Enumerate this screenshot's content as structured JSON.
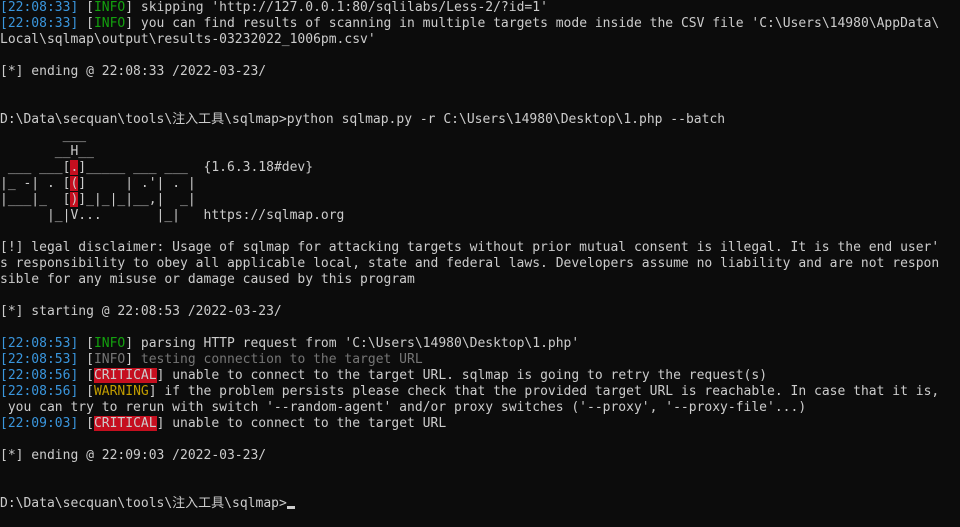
{
  "colors": {
    "background": "#0c0c0c",
    "text": "#cccccc",
    "timestamp": "#3a96dd",
    "info": "#13a10e",
    "warning": "#c19c00",
    "critical_bg": "#c50f1f",
    "dim": "#767676"
  },
  "lines": [
    {
      "segs": [
        [
          "ts",
          "[22:08:33]"
        ],
        [
          "txt",
          " ["
        ],
        [
          "info",
          "INFO"
        ],
        [
          "txt",
          "] skipping 'http://127.0.0.1:80/sqlilabs/Less-2/?id=1'"
        ]
      ]
    },
    {
      "segs": [
        [
          "ts",
          "[22:08:33]"
        ],
        [
          "txt",
          " ["
        ],
        [
          "info",
          "INFO"
        ],
        [
          "txt",
          "] you can find results of scanning in multiple targets mode inside the CSV file 'C:\\Users\\14980\\AppData\\"
        ]
      ]
    },
    {
      "segs": [
        [
          "txt",
          "Local\\sqlmap\\output\\results-03232022_1006pm.csv'"
        ]
      ]
    },
    {
      "segs": []
    },
    {
      "segs": [
        [
          "txt",
          "[*] ending @ 22:08:33 /2022-03-23/"
        ]
      ]
    },
    {
      "segs": []
    },
    {
      "segs": []
    },
    {
      "segs": [
        [
          "txt",
          "D:\\Data\\secquan\\tools\\注入工具\\sqlmap>python sqlmap.py -r C:\\Users\\14980\\Desktop\\1.php --batch"
        ]
      ]
    },
    {
      "segs": [
        [
          "logo",
          "        ___"
        ]
      ]
    },
    {
      "segs": [
        [
          "logo",
          "       __H__"
        ]
      ]
    },
    {
      "segs": [
        [
          "logo",
          " ___ ___["
        ],
        [
          "logored",
          "."
        ],
        [
          "logo",
          "]_____ ___ ___  "
        ],
        [
          "txt",
          "{1.6.3.18#dev}"
        ]
      ]
    },
    {
      "segs": [
        [
          "logo",
          "|_ -| . ["
        ],
        [
          "logored",
          "("
        ],
        [
          "logo",
          "]     | .'| . |"
        ]
      ]
    },
    {
      "segs": [
        [
          "logo",
          "|___|_  ["
        ],
        [
          "logored",
          ")"
        ],
        [
          "logo",
          "]_|_|_|__,|  _|"
        ]
      ]
    },
    {
      "segs": [
        [
          "logo",
          "      |_|V...       |_|   "
        ],
        [
          "txt",
          "https://sqlmap.org"
        ]
      ]
    },
    {
      "segs": []
    },
    {
      "segs": [
        [
          "txt",
          "[!] legal disclaimer: Usage of sqlmap for attacking targets without prior mutual consent is illegal. It is the end user'"
        ]
      ]
    },
    {
      "segs": [
        [
          "txt",
          "s responsibility to obey all applicable local, state and federal laws. Developers assume no liability and are not respon"
        ]
      ]
    },
    {
      "segs": [
        [
          "txt",
          "sible for any misuse or damage caused by this program"
        ]
      ]
    },
    {
      "segs": []
    },
    {
      "segs": [
        [
          "txt",
          "[*] starting @ 22:08:53 /2022-03-23/"
        ]
      ]
    },
    {
      "segs": []
    },
    {
      "segs": [
        [
          "ts",
          "[22:08:53]"
        ],
        [
          "txt",
          " ["
        ],
        [
          "info",
          "INFO"
        ],
        [
          "txt",
          "] parsing HTTP request from 'C:\\Users\\14980\\Desktop\\1.php'"
        ]
      ]
    },
    {
      "segs": [
        [
          "ts",
          "[22:08:53]"
        ],
        [
          "txt",
          " ["
        ],
        [
          "dim",
          "INFO"
        ],
        [
          "txt",
          "] "
        ],
        [
          "dim",
          "testing connection to the target URL"
        ]
      ]
    },
    {
      "segs": [
        [
          "ts",
          "[22:08:56]"
        ],
        [
          "txt",
          " ["
        ],
        [
          "crit",
          "CRITICAL"
        ],
        [
          "txt",
          "] unable to connect to the target URL. sqlmap is going to retry the request(s)"
        ]
      ]
    },
    {
      "segs": [
        [
          "ts",
          "[22:08:56]"
        ],
        [
          "txt",
          " ["
        ],
        [
          "warn",
          "WARNING"
        ],
        [
          "txt",
          "] if the problem persists please check that the provided target URL is reachable. In case that it is,"
        ]
      ]
    },
    {
      "segs": [
        [
          "txt",
          " you can try to rerun with switch '--random-agent' and/or proxy switches ('--proxy', '--proxy-file'...)"
        ]
      ]
    },
    {
      "segs": [
        [
          "ts",
          "[22:09:03]"
        ],
        [
          "txt",
          " ["
        ],
        [
          "crit",
          "CRITICAL"
        ],
        [
          "txt",
          "] unable to connect to the target URL"
        ]
      ]
    },
    {
      "segs": []
    },
    {
      "segs": [
        [
          "txt",
          "[*] ending @ 22:09:03 /2022-03-23/"
        ]
      ]
    },
    {
      "segs": []
    },
    {
      "segs": []
    },
    {
      "segs": [
        [
          "txt",
          "D:\\Data\\secquan\\tools\\注入工具\\sqlmap>"
        ]
      ],
      "cursor": true
    }
  ]
}
